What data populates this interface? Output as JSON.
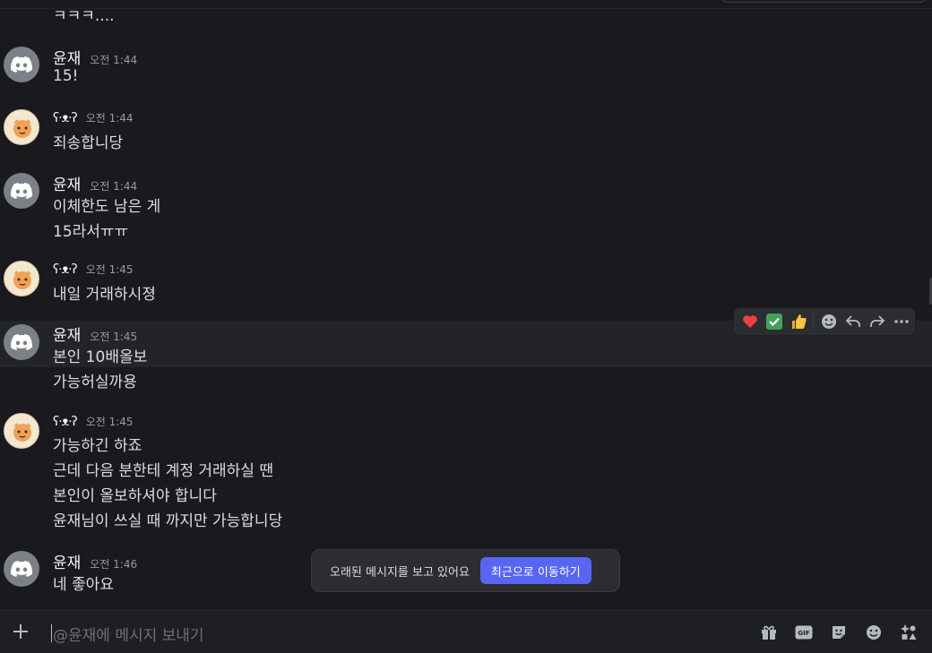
{
  "top_partial_text": "ㅋㅋㅋ....",
  "messages": [
    {
      "author": "윤재",
      "avatar": "discord-logo-icon",
      "time": "오전 1:44",
      "lines": [
        "15!"
      ]
    },
    {
      "author": "ʕ·ᴥ·ʔ",
      "avatar": "cat-avatar-icon",
      "time": "오전 1:44",
      "lines": [
        "죄송합니당"
      ]
    },
    {
      "author": "윤재",
      "avatar": "discord-logo-icon",
      "time": "오전 1:44",
      "lines": [
        "이체한도 남은 게",
        "15라서ㅠㅠ"
      ]
    },
    {
      "author": "ʕ·ᴥ·ʔ",
      "avatar": "cat-avatar-icon",
      "time": "오전 1:45",
      "lines": [
        "내일 거래하시졍"
      ]
    },
    {
      "author": "윤재",
      "avatar": "discord-logo-icon",
      "time": "오전 1:45",
      "lines": [
        "본인 10배올보",
        "가능허실까용"
      ]
    },
    {
      "author": "ʕ·ᴥ·ʔ",
      "avatar": "cat-avatar-icon",
      "time": "오전 1:45",
      "lines": [
        "가능하긴 하죠",
        "근데 다음 분한테 계정 거래하실 땐",
        "본인이 올보하셔야 합니다",
        "윤재님이 쓰실 때 까지만 가능합니당"
      ]
    },
    {
      "author": "윤재",
      "avatar": "discord-logo-icon",
      "time": "오전 1:46",
      "lines": [
        "네 좋아요"
      ]
    }
  ],
  "reaction_bar": {
    "reactions": [
      "❤️",
      "✅",
      "👍"
    ],
    "actions": [
      "add-reaction-icon",
      "reply-icon",
      "forward-icon",
      "more-icon"
    ]
  },
  "jump_bar": {
    "text": "오래된 메시지를 보고 있어요",
    "button": "최근으로 이동하기"
  },
  "composer": {
    "placeholder": "@윤재에 메시지 보내기",
    "tools": [
      "gift-icon",
      "gif-icon",
      "sticker-icon",
      "emoji-icon",
      "apps-icon"
    ]
  },
  "colors": {
    "background": "#1a1a1e",
    "accent": "#5865f2",
    "hover_row": "#232428",
    "heart": "#f23f43",
    "check": "#43a25a",
    "thumb": "#f9c33a"
  }
}
